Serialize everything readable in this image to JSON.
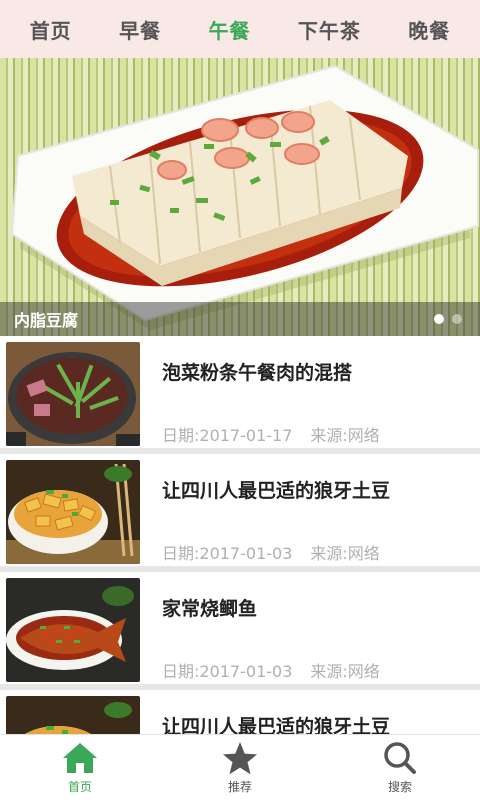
{
  "tabs": [
    {
      "label": "首页",
      "active": false
    },
    {
      "label": "早餐",
      "active": false
    },
    {
      "label": "午餐",
      "active": true
    },
    {
      "label": "下午茶",
      "active": false
    },
    {
      "label": "晚餐",
      "active": false
    }
  ],
  "banner": {
    "caption": "内脂豆腐",
    "slide_count": 2,
    "current_slide": 1
  },
  "articles": [
    {
      "title": "泡菜粉条午餐肉的混搭",
      "date": "日期:2017-01-17",
      "source": "来源:网络",
      "thumb": "pot-noodle-dish"
    },
    {
      "title": "让四川人最巴适的狼牙土豆",
      "date": "日期:2017-01-03",
      "source": "来源:网络",
      "thumb": "potato-bowl"
    },
    {
      "title": "家常烧鲫鱼",
      "date": "日期:2017-01-03",
      "source": "来源:网络",
      "thumb": "braised-fish"
    },
    {
      "title": "让四川人最巴适的狼牙土豆",
      "date": "",
      "source": "",
      "thumb": "potato-bowl"
    }
  ],
  "bottom_nav": [
    {
      "label": "首页",
      "icon": "home-icon",
      "active": true
    },
    {
      "label": "推荐",
      "icon": "star-icon",
      "active": false
    },
    {
      "label": "搜索",
      "icon": "search-icon",
      "active": false
    }
  ],
  "colors": {
    "accent": "#3aa856",
    "tab_bar_bg": "#f8e9e7",
    "meta_text": "#b0b0b0",
    "divider": "#e6e6e6"
  }
}
